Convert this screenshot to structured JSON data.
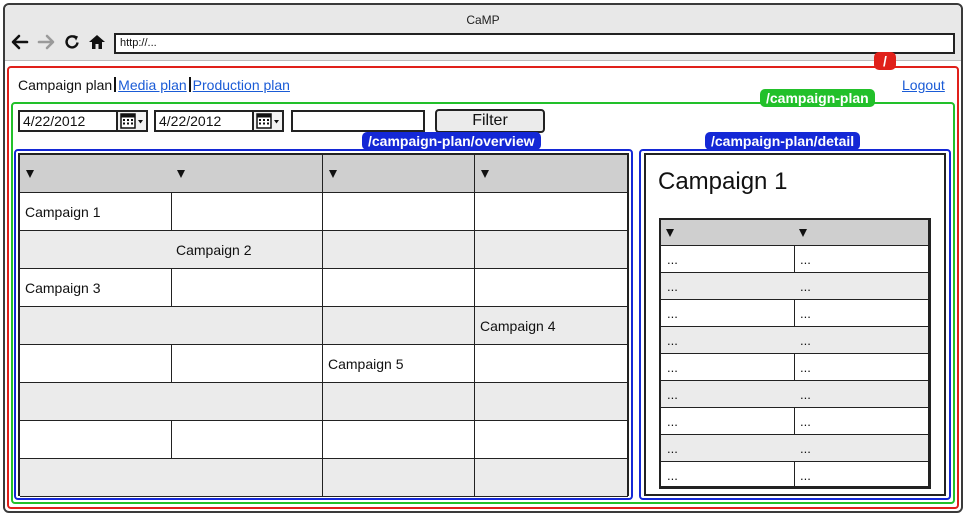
{
  "window": {
    "title": "CaMP"
  },
  "browser": {
    "url": "http://..."
  },
  "regions": {
    "root": "/",
    "plan": "/campaign-plan",
    "overview": "/campaign-plan/overview",
    "detail": "/campaign-plan/detail"
  },
  "nav": {
    "current": "Campaign plan",
    "links": [
      "Media plan",
      "Production plan"
    ],
    "logout": "Logout"
  },
  "filter": {
    "date_from": "4/22/2012",
    "date_to": "4/22/2012",
    "text": "",
    "button_label": "Filter"
  },
  "overview": {
    "columns": [
      "",
      "",
      "",
      ""
    ],
    "rows": [
      [
        "Campaign 1",
        "",
        "",
        ""
      ],
      [
        "",
        "Campaign 2",
        "",
        ""
      ],
      [
        "Campaign 3",
        "",
        "",
        ""
      ],
      [
        "",
        "",
        "",
        "Campaign 4"
      ],
      [
        "",
        "",
        "Campaign 5",
        ""
      ],
      [
        "",
        "",
        "",
        ""
      ],
      [
        "",
        "",
        "",
        ""
      ],
      [
        "",
        "",
        "",
        ""
      ]
    ]
  },
  "detail": {
    "title": "Campaign 1",
    "columns": [
      "",
      ""
    ],
    "rows": [
      [
        "...",
        "..."
      ],
      [
        "...",
        "..."
      ],
      [
        "...",
        "..."
      ],
      [
        "...",
        "..."
      ],
      [
        "...",
        "..."
      ],
      [
        "...",
        "..."
      ],
      [
        "...",
        "..."
      ],
      [
        "...",
        "..."
      ],
      [
        "...",
        "..."
      ]
    ]
  },
  "colors": {
    "root_region": "#e0201a",
    "plan_region": "#22c02a",
    "sub_regions": "#1428d6",
    "link": "#1a5bd6",
    "header_fill": "#cfcfcf",
    "alt_row_fill": "#ebebeb"
  },
  "icons": [
    "back-arrow-icon",
    "forward-arrow-icon",
    "reload-icon",
    "home-icon",
    "calendar-icon",
    "sort-triangle-icon"
  ]
}
